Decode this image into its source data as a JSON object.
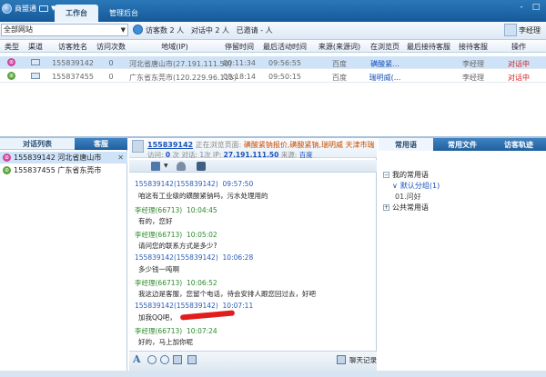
{
  "app": {
    "brand": "商盟通",
    "tabs": [
      "工作台",
      "管理后台"
    ],
    "window_buttons": [
      "-",
      "□"
    ]
  },
  "toolbar": {
    "site_select": "全部网站",
    "visitor_count": "访客数 2 人",
    "chatting": "对话中 2 人",
    "invited": "已邀请 - 人",
    "user": "李经理"
  },
  "table": {
    "headers": [
      "类型",
      "渠道",
      "访客姓名",
      "访问次数",
      "地域(IP)",
      "停留时间",
      "最后活动时间",
      "来源(来源词)",
      "在浏览页",
      "最后接待客服",
      "接待客服",
      "操作"
    ],
    "rows": [
      {
        "type_icon": "chat-status-icon",
        "channel_icon": "monitor-icon",
        "name": "155839142",
        "visits": "0",
        "region": "河北省唐山市(27.191.111.50)",
        "stay": "00:11:34",
        "last_active": "09:56:55",
        "source": "百度",
        "page": "磺酸紧...",
        "last_agent": "",
        "agent": "李经理",
        "action": "对话中"
      },
      {
        "type_icon": "chat-status-icon",
        "channel_icon": "monitor-icon",
        "name": "155837455",
        "visits": "0",
        "region": "广东省东莞市(120.229.96.115)",
        "stay": "00:18:14",
        "last_active": "09:50:15",
        "source": "百度",
        "page": "瑞明威(...",
        "last_agent": "",
        "agent": "李经理",
        "action": "对话中"
      }
    ]
  },
  "left": {
    "tabs": [
      "对话列表",
      "客服"
    ],
    "items": [
      {
        "label": "155839142 河北省唐山市",
        "close": "✕"
      },
      {
        "label": "155837455 广东省东莞市",
        "close": ""
      }
    ]
  },
  "chat": {
    "visitor_id": "155839142",
    "browsing_label": "正在浏览页面:",
    "browsing_page": "磺酸紧钠报价,磺酸紧钠,瑞明威 天津市瑞明...",
    "visit_info_label": "访问:",
    "visit_count": "0",
    "visit_info_rest": "次 对话: 1次 IP:",
    "ip": "27.191.111.50",
    "source_label": "来源:",
    "source": "百度",
    "history_label": "聊天记录",
    "messages": [
      {
        "sender": "155839142(155839142)",
        "time": "09:57:50",
        "text": "咱这有工业级的磺酸紧钠吗，污水处理用的"
      },
      {
        "sender": "李经理(66713)",
        "time": "10:04:45",
        "text": "有的，您好"
      },
      {
        "sender": "李经理(66713)",
        "time": "10:05:02",
        "text": "请问您的联系方式是多少?"
      },
      {
        "sender": "155839142(155839142)",
        "time": "10:06:28",
        "text": "多少钱一吨啊"
      },
      {
        "sender": "李经理(66713)",
        "time": "10:06:52",
        "text": "我这边是客服，您留个电话，待会安排人跟您回过去，好吧"
      },
      {
        "sender": "155839142(155839142)",
        "time": "10:07:11",
        "text": "加我QQ吧，"
      },
      {
        "sender": "李经理(66713)",
        "time": "10:07:24",
        "text": "好的，马上加你呢"
      }
    ]
  },
  "right": {
    "tabs": [
      "常用语",
      "常用文件",
      "访客轨迹"
    ],
    "tree": [
      {
        "label": "我的常用语",
        "expander": "−"
      },
      {
        "label": "默认分组(1)",
        "expander": "∨"
      },
      {
        "label": "01.问好",
        "expander": ""
      },
      {
        "label": "公共常用语",
        "expander": "+"
      }
    ]
  },
  "colors": {
    "accent": "#1f5f9e",
    "active_red": "#d42020",
    "link_blue": "#1a52b8",
    "agent_green": "#2c8a2c",
    "visitor_blue": "#2b5cb8"
  }
}
